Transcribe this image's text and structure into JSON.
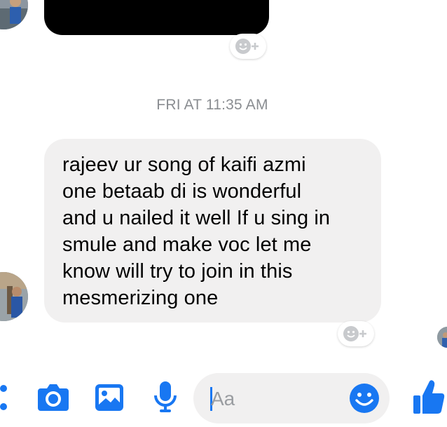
{
  "thread": {
    "timestamp": "FRI AT 11:35 AM",
    "message": {
      "text": "rajeev ur song of kaifi azmi\none betaab di is wonderful\nand u nailed it well If u sing in\nsmule and make voc let me\nknow will try to join in this\nmesmerizing one"
    }
  },
  "composer": {
    "placeholder": "Aa",
    "icons": [
      "more-icon",
      "camera-icon",
      "gallery-icon",
      "microphone-icon",
      "emoji-icon",
      "like-thumb-icon"
    ]
  },
  "colors": {
    "accent": "#1877f2",
    "bubble": "#f1f0f0",
    "timestamp": "#8a8d91"
  }
}
